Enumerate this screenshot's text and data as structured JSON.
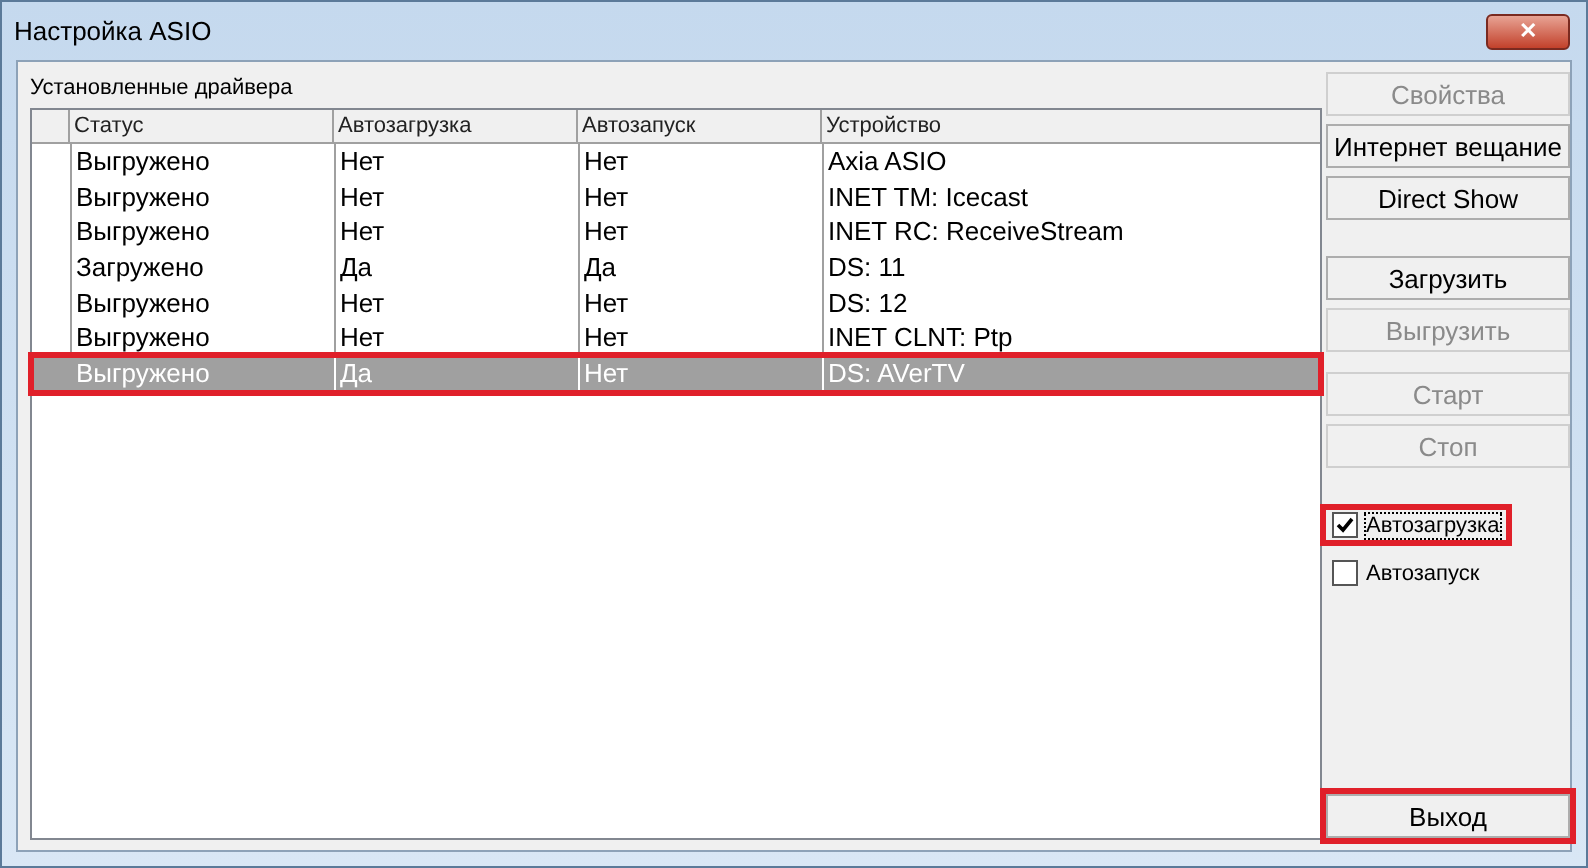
{
  "window": {
    "title": "Настройка ASIO",
    "close": "✕"
  },
  "drivers": {
    "label": "Установленные драйвера",
    "columns": [
      "Статус",
      "Автозагрузка",
      "Автозапуск",
      "Устройство"
    ],
    "rows": [
      {
        "cells": [
          "Выгружено",
          "Нет",
          "Нет",
          "Axia ASIO"
        ],
        "selected": false,
        "highlighted": false
      },
      {
        "cells": [
          "Выгружено",
          "Нет",
          "Нет",
          "INET TM: Icecast"
        ],
        "selected": false,
        "highlighted": false
      },
      {
        "cells": [
          "Выгружено",
          "Нет",
          "Нет",
          "INET RC: ReceiveStream"
        ],
        "selected": false,
        "highlighted": false
      },
      {
        "cells": [
          "Загружено",
          "Да",
          "Да",
          "DS: 11"
        ],
        "selected": false,
        "highlighted": false
      },
      {
        "cells": [
          "Выгружено",
          "Нет",
          "Нет",
          "DS: 12"
        ],
        "selected": false,
        "highlighted": false
      },
      {
        "cells": [
          "Выгружено",
          "Нет",
          "Нет",
          "INET CLNT: Ptp"
        ],
        "selected": false,
        "highlighted": false
      },
      {
        "cells": [
          "Выгружено",
          "Да",
          "Нет",
          "DS: AVerTV"
        ],
        "selected": true,
        "highlighted": true
      }
    ]
  },
  "button_groups": [
    [
      {
        "label": "Свойства",
        "disabled": true
      },
      {
        "label": "Интернет вещание",
        "disabled": false
      },
      {
        "label": "Direct Show",
        "disabled": false
      }
    ],
    [
      {
        "label": "Загрузить",
        "disabled": false
      },
      {
        "label": "Выгрузить",
        "disabled": true
      }
    ],
    [
      {
        "label": "Старт",
        "disabled": true
      },
      {
        "label": "Стоп",
        "disabled": true
      }
    ]
  ],
  "checkboxes": [
    {
      "label": "Автозагрузка",
      "checked": true,
      "highlighted": true
    },
    {
      "label": "Автозапуск",
      "checked": false,
      "highlighted": false
    }
  ],
  "exit_button": {
    "label": "Выход",
    "highlighted": true
  }
}
